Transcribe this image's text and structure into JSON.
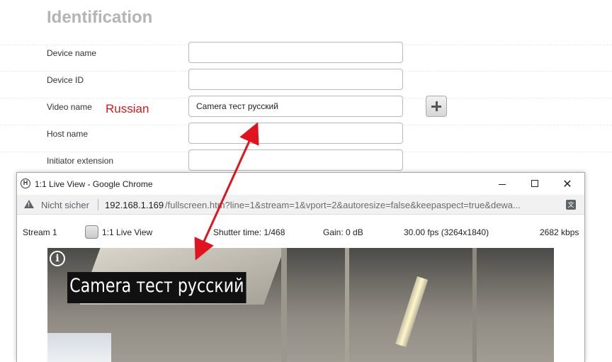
{
  "page_title": "Identification",
  "annotation": "Russian",
  "form": {
    "device_name": {
      "label": "Device name",
      "value": ""
    },
    "device_id": {
      "label": "Device ID",
      "value": ""
    },
    "video_name": {
      "label": "Video name",
      "value": "Camera тест русский"
    },
    "host_name": {
      "label": "Host name",
      "value": ""
    },
    "initiator_extension": {
      "label": "Initiator extension",
      "value": ""
    }
  },
  "popup": {
    "window_title": "1:1 Live View - Google Chrome",
    "security_label": "Nicht sicher",
    "url_host": "192.168.1.169",
    "url_path": "/fullscreen.htm?line=1&stream=1&vport=2&autoresize=false&keepaspect=true&dewa...",
    "stream_label": "Stream 1",
    "live_view_label": "1:1 Live View",
    "shutter": "Shutter time: 1/468",
    "gain": "Gain: 0 dB",
    "fps": "30.00 fps (3264x1840)",
    "bitrate": "2682 kbps",
    "video_overlay_text": "Camera тест русский"
  },
  "colors": {
    "annotation": "#e0141e",
    "title": "#b4b4b4"
  },
  "icons": {
    "add": "plus-icon",
    "app": "bosch-logo-icon",
    "security": "warning-icon",
    "translate": "translate-icon",
    "video_info": "info-icon"
  }
}
